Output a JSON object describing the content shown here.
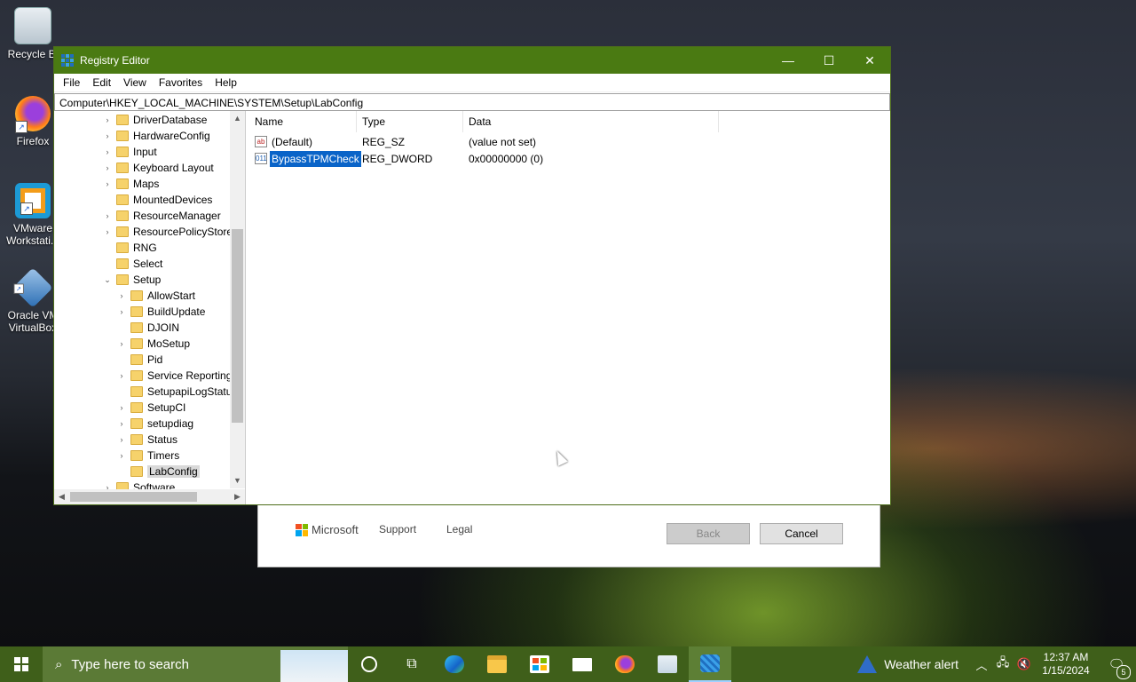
{
  "desktop": {
    "icons": [
      {
        "label": "Recycle Bi",
        "icon": "recycle-bin-icon"
      },
      {
        "label": "Firefox",
        "icon": "firefox-icon"
      },
      {
        "label": "VMware Workstati...",
        "icon": "vmware-icon"
      },
      {
        "label": "Oracle VM VirtualBox",
        "icon": "virtualbox-icon"
      }
    ]
  },
  "setup": {
    "brand": "Microsoft",
    "support": "Support",
    "legal": "Legal",
    "back": "Back",
    "cancel": "Cancel"
  },
  "window": {
    "title": "Registry Editor",
    "minimize": "—",
    "maximize": "☐",
    "close": "✕"
  },
  "menu": [
    "File",
    "Edit",
    "View",
    "Favorites",
    "Help"
  ],
  "address": "Computer\\HKEY_LOCAL_MACHINE\\SYSTEM\\Setup\\LabConfig",
  "tree": {
    "items": [
      {
        "label": "DriverDatabase",
        "level": 0,
        "expander": "›"
      },
      {
        "label": "HardwareConfig",
        "level": 0,
        "expander": "›"
      },
      {
        "label": "Input",
        "level": 0,
        "expander": "›"
      },
      {
        "label": "Keyboard Layout",
        "level": 0,
        "expander": "›"
      },
      {
        "label": "Maps",
        "level": 0,
        "expander": "›"
      },
      {
        "label": "MountedDevices",
        "level": 0,
        "expander": ""
      },
      {
        "label": "ResourceManager",
        "level": 0,
        "expander": "›"
      },
      {
        "label": "ResourcePolicyStore",
        "level": 0,
        "expander": "›"
      },
      {
        "label": "RNG",
        "level": 0,
        "expander": ""
      },
      {
        "label": "Select",
        "level": 0,
        "expander": ""
      },
      {
        "label": "Setup",
        "level": 0,
        "expander": "⌄"
      },
      {
        "label": "AllowStart",
        "level": 1,
        "expander": "›"
      },
      {
        "label": "BuildUpdate",
        "level": 1,
        "expander": "›"
      },
      {
        "label": "DJOIN",
        "level": 1,
        "expander": ""
      },
      {
        "label": "MoSetup",
        "level": 1,
        "expander": "›"
      },
      {
        "label": "Pid",
        "level": 1,
        "expander": ""
      },
      {
        "label": "Service Reporting",
        "level": 1,
        "expander": "›"
      },
      {
        "label": "SetupapiLogStatu",
        "level": 1,
        "expander": ""
      },
      {
        "label": "SetupCI",
        "level": 1,
        "expander": "›"
      },
      {
        "label": "setupdiag",
        "level": 1,
        "expander": "›"
      },
      {
        "label": "Status",
        "level": 1,
        "expander": "›"
      },
      {
        "label": "Timers",
        "level": 1,
        "expander": "›"
      },
      {
        "label": "LabConfig",
        "level": 1,
        "expander": "",
        "selected": true
      },
      {
        "label": "Software",
        "level": 0,
        "expander": "›"
      }
    ]
  },
  "list": {
    "headers": {
      "name": "Name",
      "type": "Type",
      "data": "Data"
    },
    "rows": [
      {
        "name": "(Default)",
        "type": "REG_SZ",
        "data": "(value not set)",
        "icon": "string-value-icon",
        "glyph": "ab",
        "selected": false
      },
      {
        "name": "BypassTPMCheck",
        "type": "REG_DWORD",
        "data": "0x00000000 (0)",
        "icon": "dword-value-icon",
        "glyph": "011",
        "selected": true
      }
    ]
  },
  "taskbar": {
    "search_placeholder": "Type here to search",
    "weather": "Weather alert",
    "time": "12:37 AM",
    "date": "1/15/2024",
    "notification_count": "5",
    "colors": {
      "taskbar": "#3f5f1a",
      "titlebar": "#4a7a12",
      "selection": "#0a64c8"
    }
  }
}
